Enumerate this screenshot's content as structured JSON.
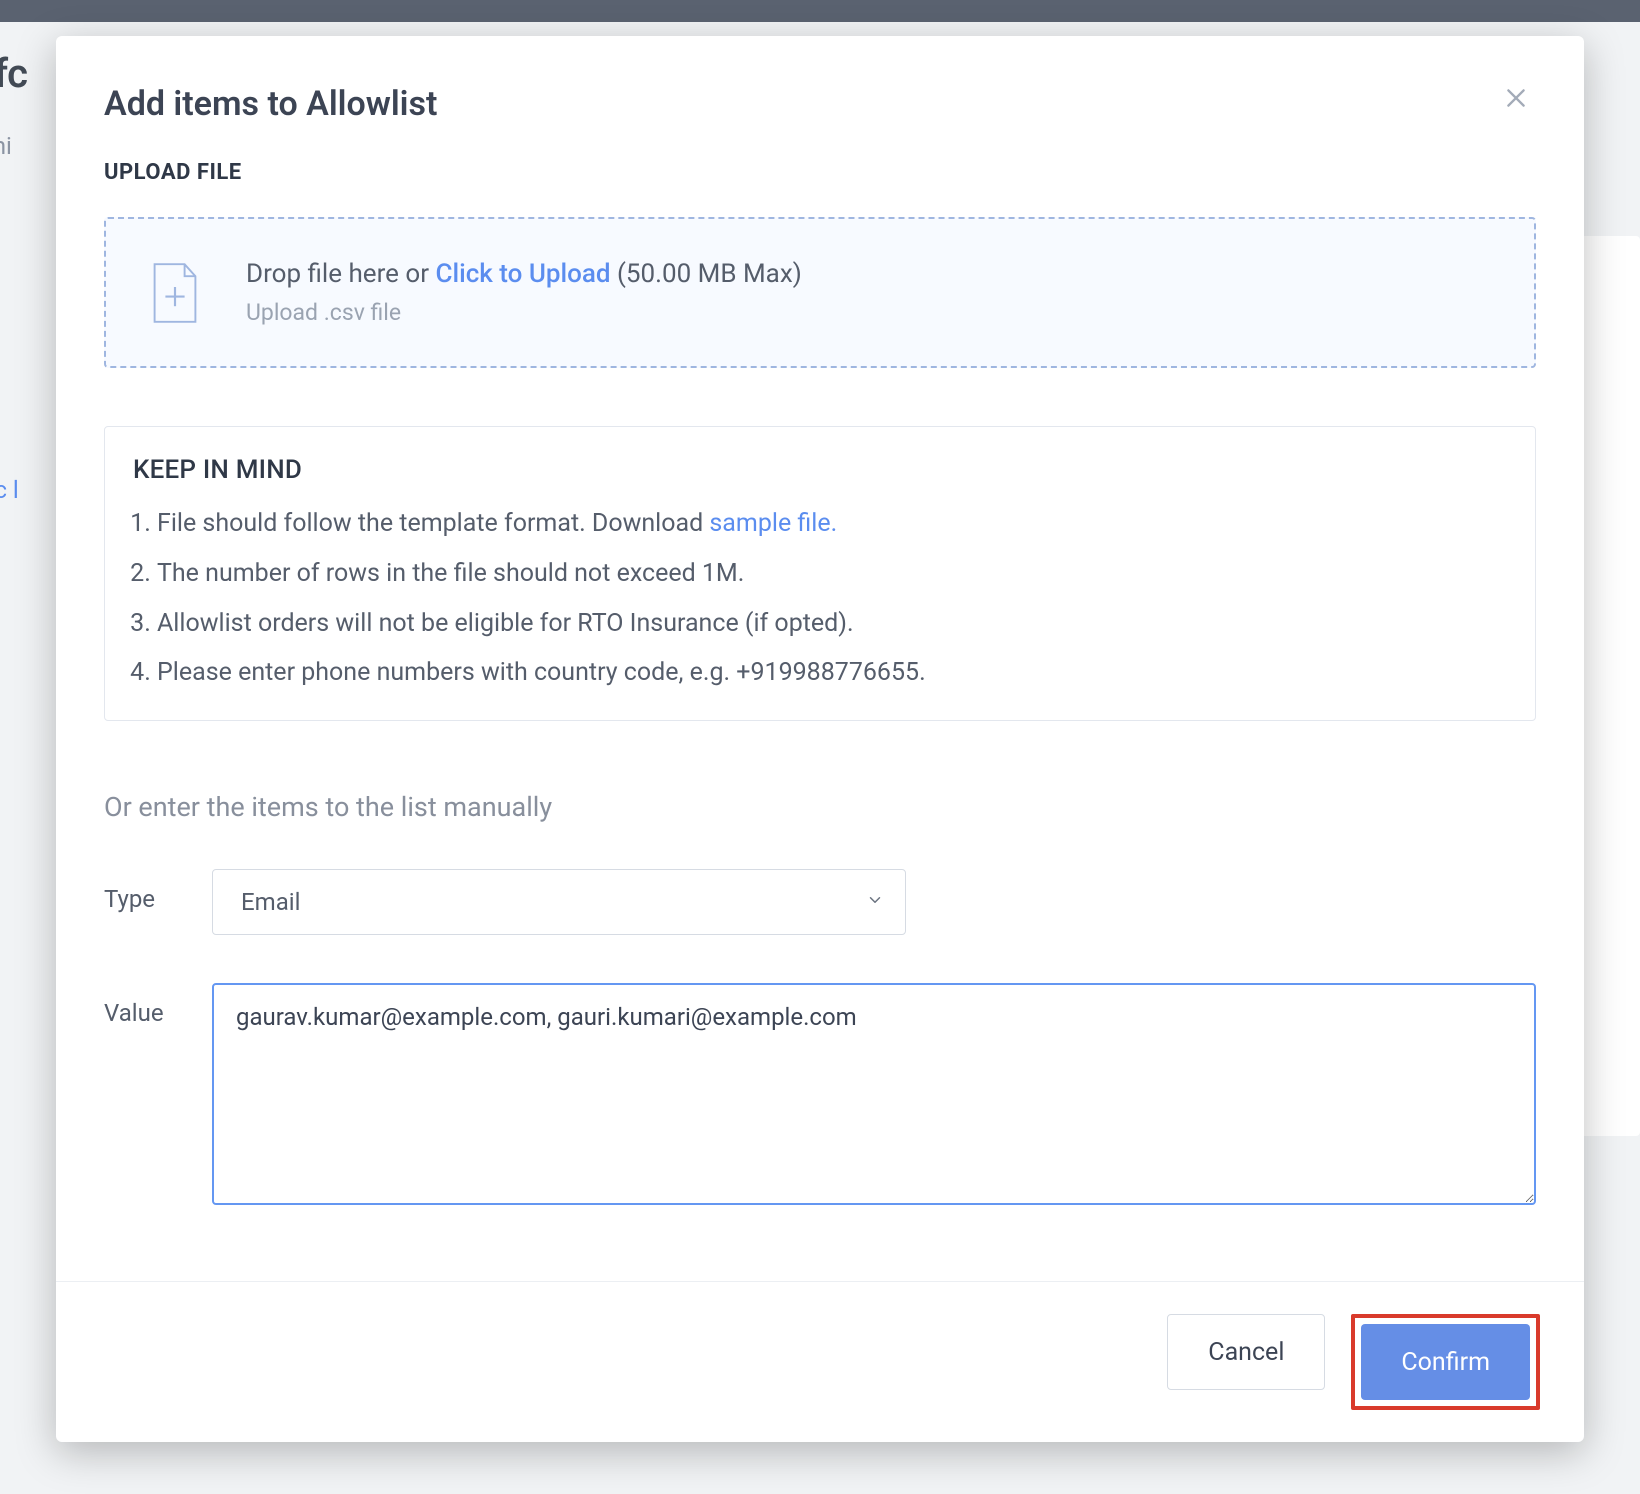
{
  "background": {
    "title_fragment": "atfc",
    "subtitle_fragment": "ocomi",
    "link_fragment": "agic l"
  },
  "modal": {
    "title": "Add items to Allowlist",
    "upload_section_label": "UPLOAD FILE",
    "dropzone": {
      "prefix": "Drop file here or ",
      "link": "Click to Upload",
      "limit": " (50.00 MB Max)",
      "subtext": "Upload .csv file"
    },
    "keep_in_mind": {
      "title": "KEEP IN MIND",
      "item1_prefix": "File should follow the template format. Download ",
      "item1_link": "sample file.",
      "item2": "The number of rows in the file should not exceed 1M.",
      "item3": "Allowlist orders will not be eligible for RTO Insurance (if opted).",
      "item4": "Please enter phone numbers with country code, e.g. +919988776655."
    },
    "manual_intro": "Or enter the items to the list manually",
    "type_label": "Type",
    "type_value": "Email",
    "value_label": "Value",
    "value_text": "gaurav.kumar@example.com, gauri.kumari@example.com",
    "cancel": "Cancel",
    "confirm": "Confirm"
  }
}
